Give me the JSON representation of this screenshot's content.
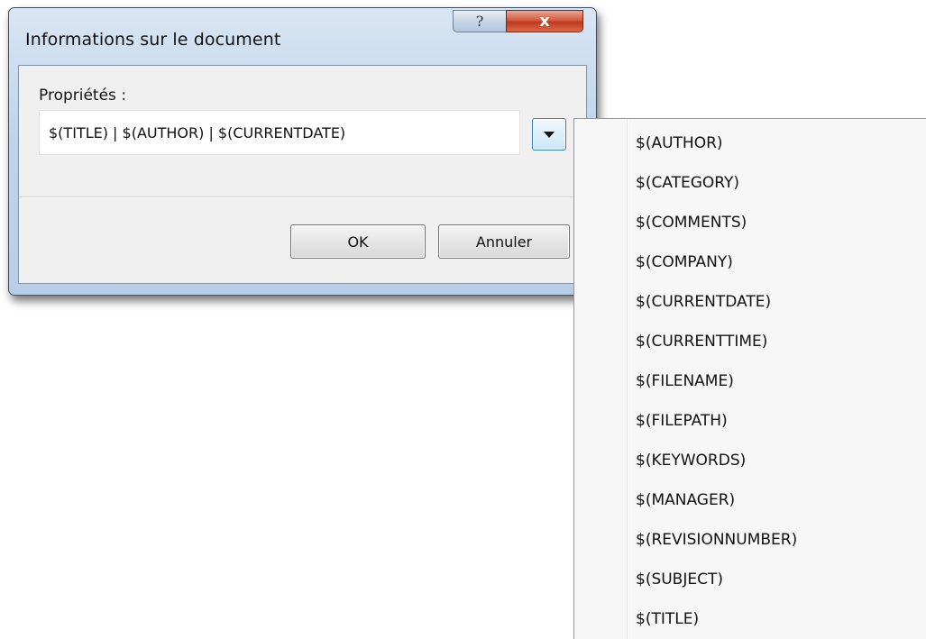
{
  "dialog": {
    "title": "Informations sur le document",
    "help_label": "?",
    "close_label": "x",
    "properties_label": "Propriétés :",
    "properties_value": "$(TITLE) | $(AUTHOR) | $(CURRENTDATE)",
    "dropdown_icon": "chevron-down-icon",
    "ok_label": "OK",
    "cancel_label": "Annuler"
  },
  "menu": {
    "items": [
      "$(AUTHOR)",
      "$(CATEGORY)",
      "$(COMMENTS)",
      "$(COMPANY)",
      "$(CURRENTDATE)",
      "$(CURRENTTIME)",
      "$(FILENAME)",
      "$(FILEPATH)",
      "$(KEYWORDS)",
      "$(MANAGER)",
      "$(REVISIONNUMBER)",
      "$(SUBJECT)",
      "$(TITLE)"
    ]
  },
  "colors": {
    "close_button": "#c8472a",
    "dialog_frame": "#bfd3ea",
    "dropdown_accent": "#3c7fb1"
  }
}
